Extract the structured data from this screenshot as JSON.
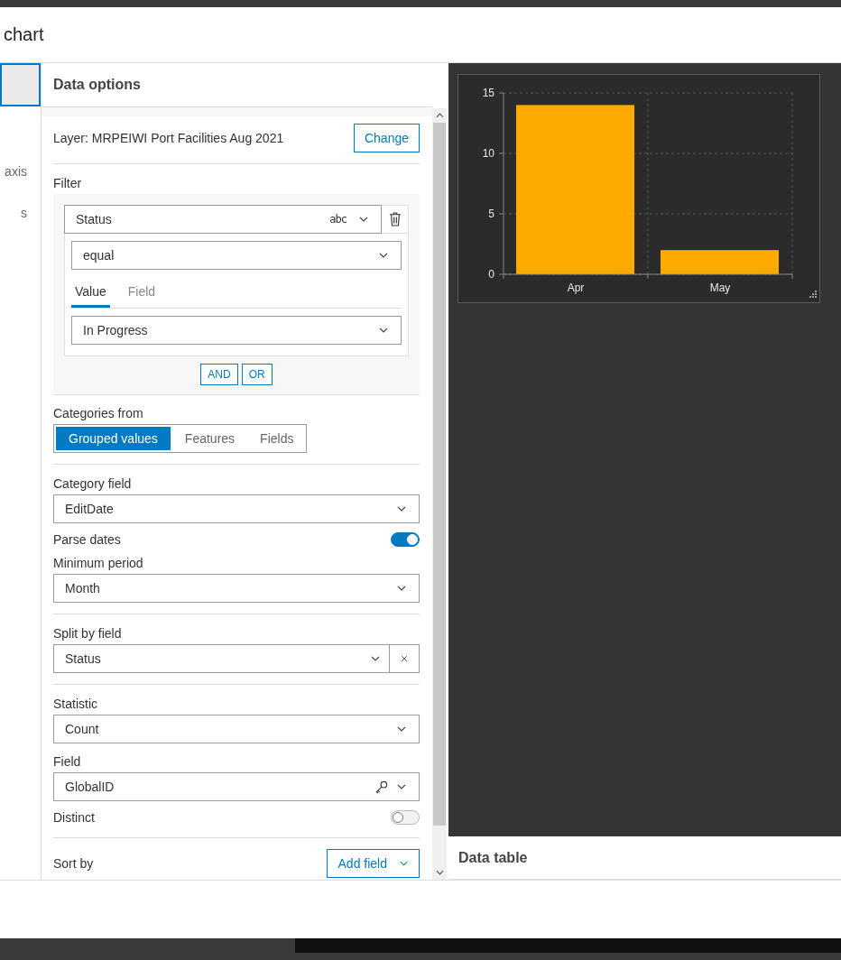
{
  "dialog": {
    "title": "chart"
  },
  "sidebar": {
    "items": [
      {
        "selected": true
      },
      {
        "label": "axis",
        "selected": false
      },
      {
        "label": "s",
        "selected": false
      }
    ]
  },
  "data_options": {
    "title": "Data options",
    "layer": "Layer: MRPEIWI Port Facilities Aug 2021",
    "change_button": "Change",
    "filter": {
      "label": "Filter",
      "field": "Status",
      "field_type": "abc",
      "operator": "equal",
      "tabs": [
        {
          "label": "Value",
          "selected": true
        },
        {
          "label": "Field",
          "selected": false
        }
      ],
      "value": "In Progress",
      "buttons": [
        "AND",
        "OR"
      ]
    },
    "categories_from": {
      "label": "Categories from",
      "options": [
        {
          "label": "Grouped values",
          "selected": true
        },
        {
          "label": "Features",
          "selected": false
        },
        {
          "label": "Fields",
          "selected": false
        }
      ]
    },
    "category_field": {
      "label": "Category field",
      "value": "EditDate"
    },
    "parse_dates": {
      "label": "Parse dates",
      "on": true
    },
    "minimum_period": {
      "label": "Minimum period",
      "value": "Month"
    },
    "split_by_field": {
      "label": "Split by field",
      "value": "Status"
    },
    "statistic": {
      "label": "Statistic",
      "value": "Count"
    },
    "field": {
      "label": "Field",
      "value": "GlobalID"
    },
    "distinct": {
      "label": "Distinct",
      "on": false
    },
    "sort_by": {
      "label": "Sort by",
      "button": "Add field"
    }
  },
  "chart": {
    "chart_data": {
      "type": "bar",
      "categories": [
        "Apr",
        "May"
      ],
      "series": [
        {
          "color": "#ffaa00",
          "values": [
            14,
            2
          ]
        }
      ],
      "ylim": [
        0,
        15
      ],
      "yticks": [
        0,
        5,
        10,
        15
      ]
    }
  },
  "data_table": {
    "title": "Data table"
  }
}
